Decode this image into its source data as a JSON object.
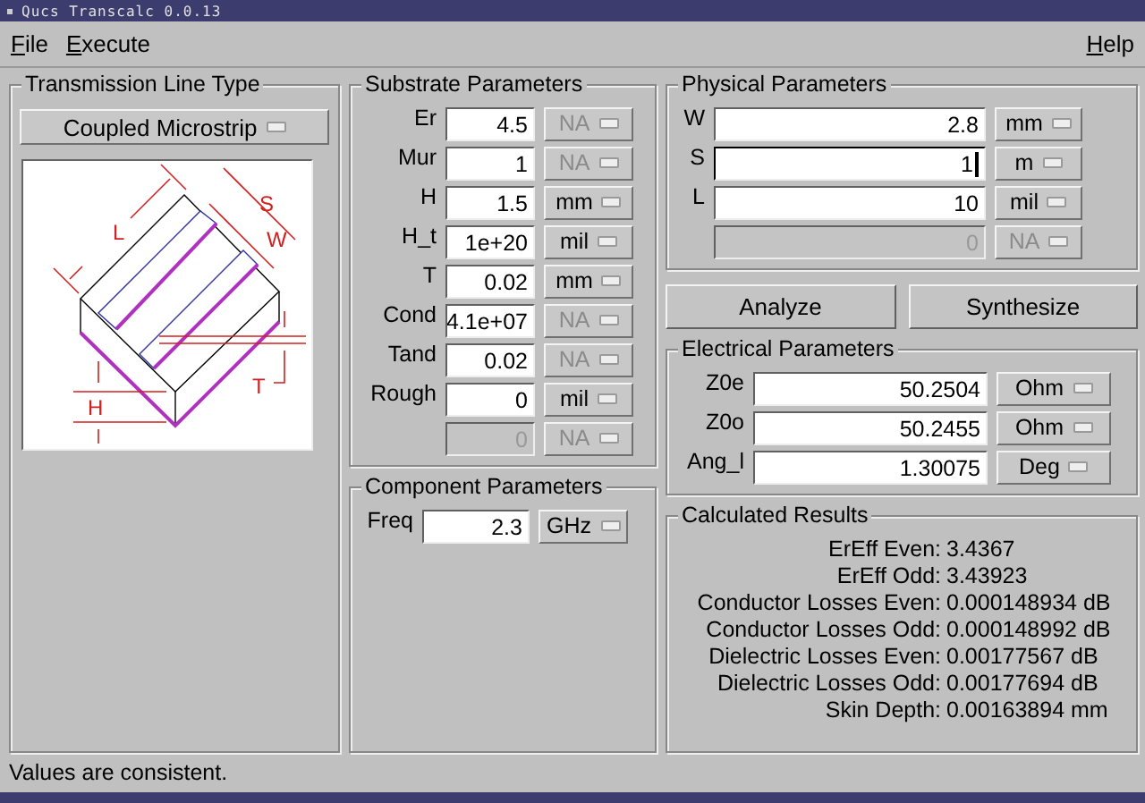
{
  "window": {
    "title": "Qucs Transcalc 0.0.13"
  },
  "menu": [
    {
      "label": "File"
    },
    {
      "label": "Execute"
    }
  ],
  "help_menu": {
    "label": "Help"
  },
  "line_type": {
    "title": "Transmission Line Type",
    "selected_type": "Coupled Microstrip",
    "diagram_labels": [
      "S",
      "L",
      "W",
      "H",
      "T"
    ]
  },
  "substrate": {
    "title": "Substrate Parameters",
    "rows": [
      {
        "label": "Er",
        "value": "4.5",
        "unit": "NA",
        "input_disabled": false,
        "unit_disabled": true
      },
      {
        "label": "Mur",
        "value": "1",
        "unit": "NA",
        "input_disabled": false,
        "unit_disabled": true
      },
      {
        "label": "H",
        "value": "1.5",
        "unit": "mm",
        "input_disabled": false,
        "unit_disabled": false
      },
      {
        "label": "H_t",
        "value": "1e+20",
        "unit": "mil",
        "input_disabled": false,
        "unit_disabled": false
      },
      {
        "label": "T",
        "value": "0.02",
        "unit": "mm",
        "input_disabled": false,
        "unit_disabled": false
      },
      {
        "label": "Cond",
        "value": "4.1e+07",
        "unit": "NA",
        "input_disabled": false,
        "unit_disabled": true
      },
      {
        "label": "Tand",
        "value": "0.02",
        "unit": "NA",
        "input_disabled": false,
        "unit_disabled": true
      },
      {
        "label": "Rough",
        "value": "0",
        "unit": "mil",
        "input_disabled": false,
        "unit_disabled": false
      },
      {
        "value": "0",
        "unit": "NA",
        "input_disabled": true,
        "unit_disabled": true
      }
    ]
  },
  "component": {
    "title": "Component Parameters",
    "rows": [
      {
        "label": "Freq",
        "value": "2.3",
        "unit": "GHz",
        "input_disabled": false,
        "unit_disabled": false
      }
    ]
  },
  "physical": {
    "title": "Physical Parameters",
    "rows": [
      {
        "label": "W",
        "value": "2.8",
        "unit": "mm",
        "input_disabled": false,
        "unit_disabled": false,
        "focused": false
      },
      {
        "label": "S",
        "value": "1",
        "unit": "m",
        "input_disabled": false,
        "unit_disabled": false,
        "focused": true
      },
      {
        "label": "L",
        "value": "10",
        "unit": "mil",
        "input_disabled": false,
        "unit_disabled": false,
        "focused": false
      },
      {
        "value": "0",
        "unit": "NA",
        "input_disabled": true,
        "unit_disabled": true,
        "focused": false
      }
    ]
  },
  "buttons": [
    {
      "label": "Analyze"
    },
    {
      "label": "Synthesize"
    }
  ],
  "electrical": {
    "title": "Electrical Parameters",
    "rows": [
      {
        "label": "Z0e",
        "value": "50.2504",
        "unit": "Ohm",
        "input_disabled": false,
        "unit_disabled": false
      },
      {
        "label": "Z0o",
        "value": "50.2455",
        "unit": "Ohm",
        "input_disabled": false,
        "unit_disabled": false
      },
      {
        "label": "Ang_l",
        "value": "1.30075",
        "unit": "Deg",
        "input_disabled": false,
        "unit_disabled": false
      }
    ]
  },
  "results": {
    "title": "Calculated Results",
    "rows": [
      {
        "label": "ErEff Even:",
        "value": "3.4367"
      },
      {
        "label": "ErEff Odd:",
        "value": "3.43923"
      },
      {
        "label": "Conductor Losses Even:",
        "value": "0.000148934 dB"
      },
      {
        "label": "Conductor Losses Odd:",
        "value": "0.000148992 dB"
      },
      {
        "label": "Dielectric Losses Even:",
        "value": "0.00177567 dB"
      },
      {
        "label": "Dielectric Losses Odd:",
        "value": "0.00177694 dB"
      },
      {
        "label": "Skin Depth:",
        "value": "0.00163894 mm"
      }
    ]
  },
  "status_bar": "Values are consistent."
}
